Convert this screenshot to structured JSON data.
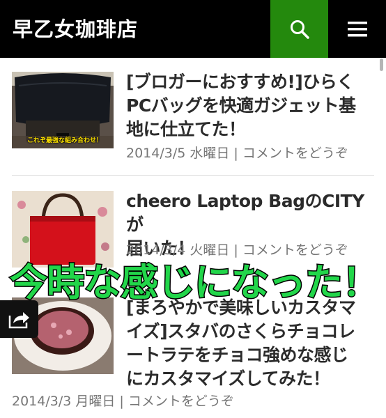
{
  "header": {
    "site_title": "早乙女珈琲店",
    "search_icon": "search-icon",
    "menu_icon": "hamburger-menu-icon",
    "search_bg": "#24890d"
  },
  "posts": [
    {
      "title_lines": [
        "[ブロガーにおすすめ!]ひらく",
        "PCバッグを快適ガジェット基",
        "地に仕立てた！"
      ],
      "meta": "2014/3/5 水曜日 | コメントをどうぞ",
      "thumb_caption": "これぞ最強な組み合わせ！"
    },
    {
      "title_lines": [
        "cheero Laptop BagのCITYが",
        "届いた！"
      ],
      "meta": "2014/3/4 火曜日 | コメントをどうぞ"
    },
    {
      "title_lines": [
        "[まろやかで美味しいカスタマ",
        "イズ]スタバのさくらチョコレ",
        "ートラテをチョコ強めな感じ",
        "にカスタマイズしてみた！"
      ],
      "meta": "2014/3/3 月曜日 | コメントをどうぞ"
    }
  ],
  "overlay_caption": "今時な感じになった！",
  "share_icon": "share-icon"
}
